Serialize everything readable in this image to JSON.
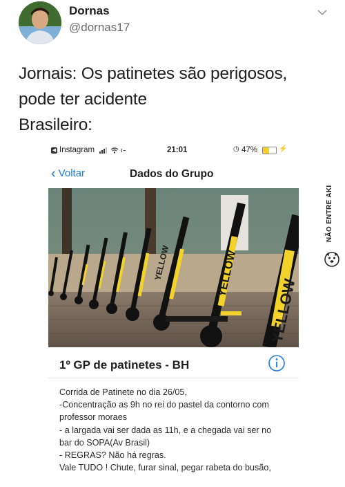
{
  "tweet": {
    "display_name": "Dornas",
    "handle": "@dornas17",
    "text_lines": [
      "Jornais: Os patinetes são perigosos,",
      "pode ter acidente",
      "Brasileiro:"
    ]
  },
  "screenshot": {
    "status_bar": {
      "app": "Instagram",
      "time": "21:01",
      "battery": "47%",
      "battery_level": 0.47
    },
    "nav": {
      "back_label": "Voltar",
      "title": "Dados do Grupo"
    },
    "photo_labels": [
      "YELLOW",
      "YELLOW",
      "YELLOW"
    ],
    "group_name": "1º GP de patinetes - BH",
    "description_lines": [
      "Corrida de Patinete no dia 26/05,",
      "-Concentração as 9h no rei do pastel da contorno com",
      "professor moraes",
      "- a largada vai ser dada as 11h, e a chegada vai ser no",
      "bar do SOPA(Av Brasil)",
      "- REGRAS? Não há regras.",
      "Vale TUDO ! Chute, furar sinal, pegar rabeta do busão,"
    ]
  },
  "watermark": "NÃO ENTRE AKI",
  "colors": {
    "ios_blue": "#1a7ae6",
    "scooter_yellow": "#f2d22b"
  }
}
